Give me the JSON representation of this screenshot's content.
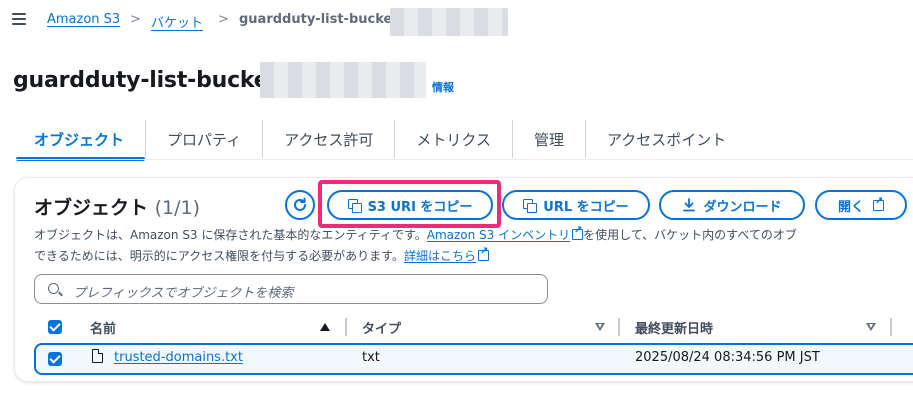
{
  "breadcrumb": {
    "items": [
      "Amazon S3",
      "バケット",
      "guardduty-list-bucket-"
    ],
    "separator": ">"
  },
  "header": {
    "title": "guardduty-list-bucket-",
    "info": "情報"
  },
  "tabs": [
    {
      "label": "オブジェクト",
      "active": true
    },
    {
      "label": "プロパティ"
    },
    {
      "label": "アクセス許可"
    },
    {
      "label": "メトリクス"
    },
    {
      "label": "管理"
    },
    {
      "label": "アクセスポイント"
    }
  ],
  "objects": {
    "title": "オブジェクト",
    "count": "(1/1)",
    "buttons": {
      "copy_s3_uri": "S3 URI をコピー",
      "copy_url": "URL をコピー",
      "download": "ダウンロード",
      "open": "開く"
    },
    "description": {
      "line1_a": "オブジェクトは、Amazon S3 に保存された基本的なエンティティです。",
      "inventory_link": "Amazon S3 インベントリ",
      "line1_b": "を使用して、バケット内のすべてのオブ",
      "line2_a": "できるためには、明示的にアクセス権限を付与する必要があります。",
      "details_link": "詳細はこちら"
    },
    "search_placeholder": "プレフィックスでオブジェクトを検索",
    "columns": [
      "名前",
      "タイプ",
      "最終更新日時"
    ],
    "rows": [
      {
        "name": "trusted-domains.txt",
        "type": "txt",
        "modified": "2025/08/24 08:34:56 PM JST"
      }
    ]
  },
  "colors": {
    "accent": "#0972d3",
    "highlight": "#f0297a"
  }
}
